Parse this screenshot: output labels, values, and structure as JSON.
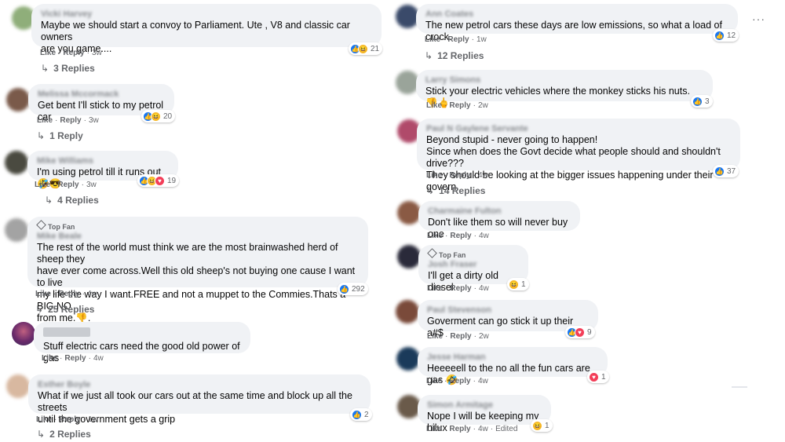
{
  "theme": {
    "bubble_bg": "#f0f2f5",
    "like_blue": "#1877f2",
    "meta_gray": "#65676b"
  },
  "labels": {
    "like": "Like",
    "reply": "Reply",
    "top_fan": "Top Fan",
    "edited": "Edited"
  },
  "left": [
    {
      "name": "Vicki Harvey",
      "text": "Maybe we should start a convoy to Parliament. Ute , V8 and classic car owners\nare you game....",
      "time": "3w",
      "reactions": [
        "like",
        "haha"
      ],
      "count": "21",
      "replies": "3 Replies"
    },
    {
      "name": "Melissa Mccormack",
      "text": "Get bent I'll stick to my petrol car",
      "time": "3w",
      "reactions": [
        "like",
        "haha"
      ],
      "count": "20",
      "replies": "1 Reply"
    },
    {
      "name": "Mike Williams",
      "text": "I'm using petrol till it runs out 🤣😎",
      "time": "3w",
      "reactions": [
        "like",
        "haha",
        "love"
      ],
      "count": "19",
      "replies": "4 Replies"
    },
    {
      "name": "Mike Beale",
      "top_fan": true,
      "text": "The rest of the world must think we are the most brainwashed herd of sheep they\nhave ever come across.Well this old sheep's not buying one cause I want to live\nmy life the way I want.FREE and not a muppet to the Commies.Thats a BIG NO\nfrom me.👎.",
      "time": "4w",
      "reactions": [
        "like"
      ],
      "count": "292",
      "replies": "25 Replies"
    },
    {
      "name": "",
      "text": "Stuff electric cars need the good old power of gas",
      "time": "4w"
    },
    {
      "name": "Esther Boyle",
      "text": "What if we just all took our cars out at the same time and block up all the streets\nuntil the government gets a grip",
      "time": "1w",
      "reactions": [
        "like"
      ],
      "count": "2",
      "replies": "2 Replies"
    }
  ],
  "right": [
    {
      "name": "Ann Coates",
      "text": "The new petrol cars these days are low emissions, so what a load of crock.",
      "time": "1w",
      "reactions": [
        "like"
      ],
      "count": "12",
      "replies": "12 Replies"
    },
    {
      "name": "Larry Simons",
      "text": "Stick your electric vehicles where the monkey sticks his nuts. 👎🖕",
      "time": "2w",
      "reactions": [
        "like"
      ],
      "count": "3"
    },
    {
      "name": "Paul N Gaylene Servante",
      "text": "Beyond stupid - never going to happen!\nSince when does the Govt decide what people should and shouldn't drive???\nThey should be looking at the bigger issues happening under their govern.",
      "time": "4w",
      "reactions": [
        "like"
      ],
      "count": "37",
      "replies": "14 Replies"
    },
    {
      "name": "Charmaine Fulton",
      "text": "Don't like them so will never buy one",
      "time": "4w"
    },
    {
      "name": "Josh Fraser",
      "top_fan": true,
      "text": "I'll get a dirty old diesel",
      "time": "4w",
      "reactions": [
        "haha"
      ],
      "count": "1"
    },
    {
      "name": "Paul Stevenson",
      "text": "Goverment can go stick it up their a#$",
      "time": "2w",
      "reactions": [
        "like",
        "love"
      ],
      "count": "9"
    },
    {
      "name": "Jesse Harman",
      "text": "Heeeeell to the no all the fun cars are gas 🤣",
      "time": "4w",
      "reactions": [
        "love"
      ],
      "count": "1"
    },
    {
      "name": "Simon Armitage",
      "text": "Nope I will be keeping my hilux",
      "time": "4w",
      "edited": true,
      "reactions": [
        "haha"
      ],
      "count": "1"
    }
  ]
}
